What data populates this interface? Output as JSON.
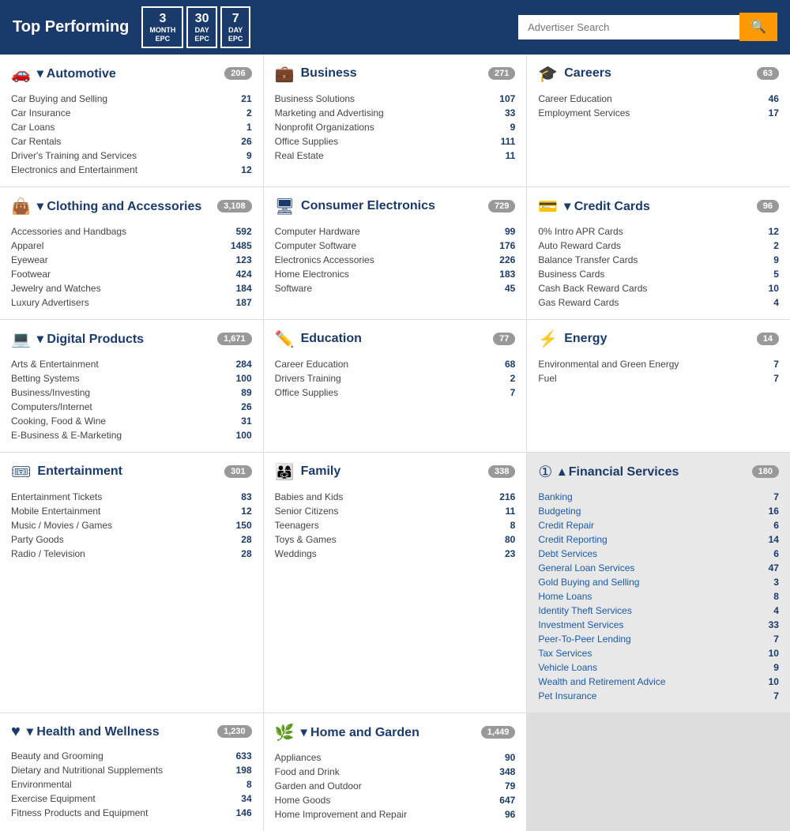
{
  "header": {
    "title": "Top Performing",
    "epc_buttons": [
      {
        "num": "3",
        "lbl": "MONTH\nEPC"
      },
      {
        "num": "30",
        "lbl": "DAY\nEPC"
      },
      {
        "num": "7",
        "lbl": "DAY\nEPC"
      }
    ],
    "search_placeholder": "Advertiser Search",
    "search_icon": "🔍"
  },
  "categories": [
    {
      "id": "automotive",
      "icon": "🚗",
      "title": "Automotive",
      "arrow": "down",
      "count": "206",
      "subs": [
        {
          "name": "Car Buying and Selling",
          "count": "21"
        },
        {
          "name": "Car Insurance",
          "count": "2"
        },
        {
          "name": "Car Loans",
          "count": "1"
        },
        {
          "name": "Car Rentals",
          "count": "26"
        },
        {
          "name": "Driver's Training and Services",
          "count": "9"
        },
        {
          "name": "Electronics and Entertainment",
          "count": "12"
        }
      ]
    },
    {
      "id": "business",
      "icon": "💼",
      "title": "Business",
      "arrow": "none",
      "count": "271",
      "subs": [
        {
          "name": "Business Solutions",
          "count": "107"
        },
        {
          "name": "Marketing and Advertising",
          "count": "33"
        },
        {
          "name": "Nonprofit Organizations",
          "count": "9"
        },
        {
          "name": "Office Supplies",
          "count": "111"
        },
        {
          "name": "Real Estate",
          "count": "11"
        }
      ]
    },
    {
      "id": "careers",
      "icon": "🎓",
      "title": "Careers",
      "arrow": "none",
      "count": "63",
      "subs": [
        {
          "name": "Career Education",
          "count": "46"
        },
        {
          "name": "Employment Services",
          "count": "17"
        }
      ]
    },
    {
      "id": "clothing",
      "icon": "👜",
      "title": "Clothing and Accessories",
      "arrow": "down",
      "count": "3,108",
      "subs": [
        {
          "name": "Accessories and Handbags",
          "count": "592"
        },
        {
          "name": "Apparel",
          "count": "1485"
        },
        {
          "name": "Eyewear",
          "count": "123"
        },
        {
          "name": "Footwear",
          "count": "424"
        },
        {
          "name": "Jewelry and Watches",
          "count": "184"
        },
        {
          "name": "Luxury Advertisers",
          "count": "187"
        }
      ]
    },
    {
      "id": "consumer-electronics",
      "icon": "🖥",
      "title": "Consumer Electronics",
      "arrow": "none",
      "count": "729",
      "subs": [
        {
          "name": "Computer Hardware",
          "count": "99"
        },
        {
          "name": "Computer Software",
          "count": "176"
        },
        {
          "name": "Electronics Accessories",
          "count": "226"
        },
        {
          "name": "Home Electronics",
          "count": "183"
        },
        {
          "name": "Software",
          "count": "45"
        }
      ]
    },
    {
      "id": "credit-cards",
      "icon": "💳",
      "title": "Credit Cards",
      "arrow": "down",
      "count": "96",
      "subs": [
        {
          "name": "0% Intro APR Cards",
          "count": "12"
        },
        {
          "name": "Auto Reward Cards",
          "count": "2"
        },
        {
          "name": "Balance Transfer Cards",
          "count": "9"
        },
        {
          "name": "Business Cards",
          "count": "5"
        },
        {
          "name": "Cash Back Reward Cards",
          "count": "10"
        },
        {
          "name": "Gas Reward Cards",
          "count": "4"
        }
      ]
    },
    {
      "id": "digital-products",
      "icon": "💻",
      "title": "Digital Products",
      "arrow": "down",
      "count": "1,671",
      "subs": [
        {
          "name": "Arts & Entertainment",
          "count": "284"
        },
        {
          "name": "Betting Systems",
          "count": "100"
        },
        {
          "name": "Business/Investing",
          "count": "89"
        },
        {
          "name": "Computers/Internet",
          "count": "26"
        },
        {
          "name": "Cooking, Food & Wine",
          "count": "31"
        },
        {
          "name": "E-Business & E-Marketing",
          "count": "100"
        }
      ]
    },
    {
      "id": "education",
      "icon": "✏️",
      "title": "Education",
      "arrow": "none",
      "count": "77",
      "subs": [
        {
          "name": "Career Education",
          "count": "68"
        },
        {
          "name": "Drivers Training",
          "count": "2"
        },
        {
          "name": "Office Supplies",
          "count": "7"
        }
      ]
    },
    {
      "id": "energy",
      "icon": "⚡",
      "title": "Energy",
      "arrow": "none",
      "count": "14",
      "subs": [
        {
          "name": "Environmental and Green Energy",
          "count": "7"
        },
        {
          "name": "Fuel",
          "count": "7"
        }
      ]
    },
    {
      "id": "entertainment",
      "icon": "🎟",
      "title": "Entertainment",
      "arrow": "none",
      "count": "301",
      "subs": [
        {
          "name": "Entertainment Tickets",
          "count": "83"
        },
        {
          "name": "Mobile Entertainment",
          "count": "12"
        },
        {
          "name": "Music / Movies / Games",
          "count": "150"
        },
        {
          "name": "Party Goods",
          "count": "28"
        },
        {
          "name": "Radio / Television",
          "count": "28"
        }
      ]
    },
    {
      "id": "family",
      "icon": "👨‍👩‍👧‍👦",
      "title": "Family",
      "arrow": "none",
      "count": "338",
      "subs": [
        {
          "name": "Babies and Kids",
          "count": "216"
        },
        {
          "name": "Senior Citizens",
          "count": "11"
        },
        {
          "name": "Teenagers",
          "count": "8"
        },
        {
          "name": "Toys & Games",
          "count": "80"
        },
        {
          "name": "Weddings",
          "count": "23"
        }
      ]
    },
    {
      "id": "financial-services",
      "icon": "💰",
      "title": "Financial Services",
      "arrow": "up",
      "count": "180",
      "financial": true,
      "subs": [
        {
          "name": "Banking",
          "count": "7"
        },
        {
          "name": "Budgeting",
          "count": "16"
        },
        {
          "name": "Credit Repair",
          "count": "6"
        },
        {
          "name": "Credit Reporting",
          "count": "14"
        },
        {
          "name": "Debt Services",
          "count": "6"
        },
        {
          "name": "General Loan Services",
          "count": "47"
        },
        {
          "name": "Gold Buying and Selling",
          "count": "3"
        },
        {
          "name": "Home Loans",
          "count": "8"
        },
        {
          "name": "Identity Theft Services",
          "count": "4"
        },
        {
          "name": "Investment Services",
          "count": "33"
        },
        {
          "name": "Peer-To-Peer Lending",
          "count": "7"
        },
        {
          "name": "Tax Services",
          "count": "10"
        },
        {
          "name": "Vehicle Loans",
          "count": "9"
        },
        {
          "name": "Wealth and Retirement Advice",
          "count": "10"
        }
      ]
    },
    {
      "id": "health-wellness",
      "icon": "💗",
      "title": "Health and Wellness",
      "arrow": "down",
      "count": "1,230",
      "subs": [
        {
          "name": "Beauty and Grooming",
          "count": "633"
        },
        {
          "name": "Dietary and Nutritional Supplements",
          "count": "198"
        },
        {
          "name": "Environmental",
          "count": "8"
        },
        {
          "name": "Exercise Equipment",
          "count": "34"
        },
        {
          "name": "Fitness Products and Equipment",
          "count": "146"
        }
      ]
    },
    {
      "id": "home-garden",
      "icon": "🌿",
      "title": "Home and Garden",
      "arrow": "down",
      "count": "1,449",
      "subs": [
        {
          "name": "Appliances",
          "count": "90"
        },
        {
          "name": "Food and Drink",
          "count": "348"
        },
        {
          "name": "Garden and Outdoor",
          "count": "79"
        },
        {
          "name": "Home Goods",
          "count": "647"
        },
        {
          "name": "Home Improvement and Repair",
          "count": "96"
        }
      ]
    },
    {
      "id": "pet-insurance",
      "icon": "🐾",
      "title": "Pet Insurance",
      "arrow": "none",
      "count": "7",
      "financial_extra": true,
      "subs": []
    }
  ]
}
